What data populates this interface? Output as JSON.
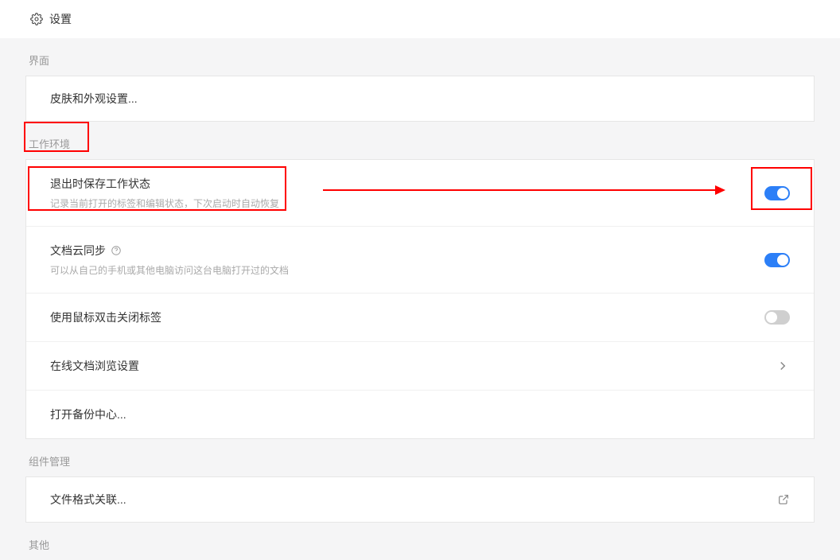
{
  "header": {
    "title": "设置"
  },
  "sections": {
    "interface": {
      "label": "界面",
      "skin_row": "皮肤和外观设置..."
    },
    "work_env": {
      "label": "工作环境",
      "save_state": {
        "title": "退出时保存工作状态",
        "desc": "记录当前打开的标签和编辑状态，下次启动时自动恢复",
        "on": true
      },
      "cloud_sync": {
        "title": "文档云同步",
        "desc": "可以从自己的手机或其他电脑访问这台电脑打开过的文档",
        "on": true
      },
      "dbl_click_close": {
        "title": "使用鼠标双击关闭标签",
        "on": false
      },
      "online_preview": {
        "title": "在线文档浏览设置"
      },
      "backup_center": {
        "title": "打开备份中心..."
      }
    },
    "component_mgmt": {
      "label": "组件管理",
      "file_assoc": {
        "title": "文件格式关联..."
      }
    },
    "other": {
      "label": "其他"
    }
  }
}
